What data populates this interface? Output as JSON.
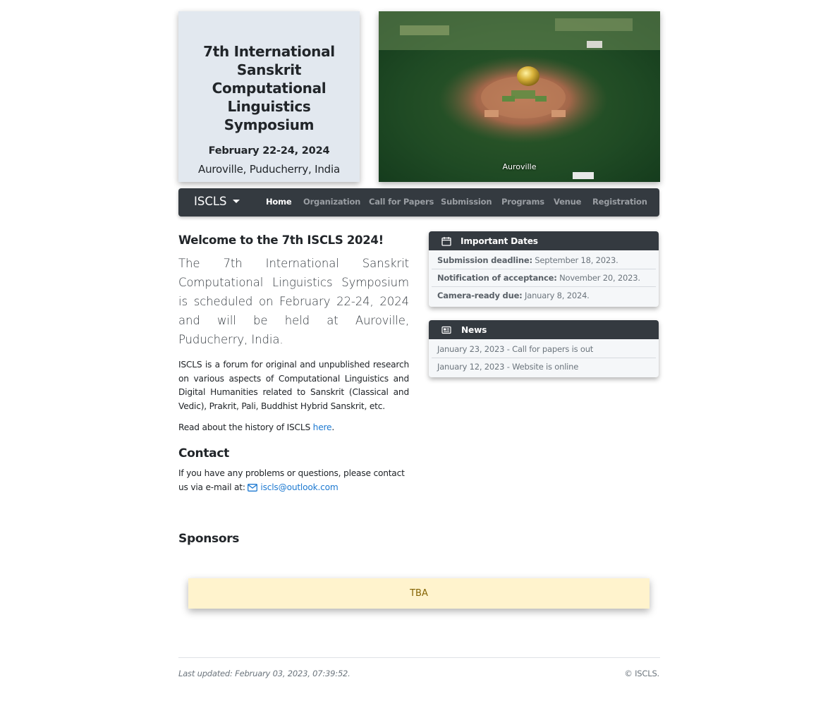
{
  "header": {
    "title": "7th International Sanskrit Computational Linguistics Symposium",
    "dates": "February 22-24, 2024",
    "location": "Auroville, Puducherry, India",
    "photo_caption": "Auroville"
  },
  "navbar": {
    "brand": "ISCLS",
    "items": [
      {
        "label": "Home",
        "active": true
      },
      {
        "label": "Organization",
        "active": false
      },
      {
        "label": "Call for Papers",
        "active": false
      },
      {
        "label": "Submission",
        "active": false
      },
      {
        "label": "Programs",
        "active": false
      },
      {
        "label": "Venue",
        "active": false
      },
      {
        "label": "Registration",
        "active": false
      }
    ]
  },
  "main": {
    "welcome_heading": "Welcome to the 7th ISCLS 2024!",
    "lead": "The 7th International Sanskrit Computational Linguistics Symposium is scheduled on February 22-24, 2024 and will be held at Auroville, Puducherry, India.",
    "description": "ISCLS is a forum for original and unpublished research on various aspects of Computational Linguistics and Digital Humanities related to Sanskrit (Classical and Vedic), Prakrit, Pali, Buddhist Hybrid Sanskrit, etc.",
    "history_text": "Read about the history of ISCLS ",
    "history_link": "here",
    "history_end": ".",
    "contact_heading": "Contact",
    "contact_text": "If you have any problems or questions, please contact us via e-mail at: ",
    "contact_email": "iscls@outlook.com"
  },
  "important_dates": {
    "title": "Important Dates",
    "icon": "calendar-icon",
    "rows": [
      {
        "label": "Submission deadline:",
        "value": " September 18, 2023."
      },
      {
        "label": "Notification of acceptance:",
        "value": " November 20, 2023."
      },
      {
        "label": "Camera-ready due:",
        "value": " January 8, 2024."
      }
    ]
  },
  "news": {
    "title": "News",
    "icon": "newspaper-icon",
    "items": [
      "January 23, 2023 - Call for papers is out",
      "January 12, 2023 - Website is online"
    ]
  },
  "sponsors": {
    "heading": "Sponsors",
    "placeholder": "TBA"
  },
  "footer": {
    "last_updated": "Last updated: February 03, 2023, 07:39:52.",
    "copyright": "© ISCLS."
  },
  "colors": {
    "navbar_bg": "#343a40",
    "title_card_bg": "#e2e8ef",
    "link": "#1e7ad1",
    "tba_bg": "#fff3cd",
    "tba_text": "#856404"
  }
}
